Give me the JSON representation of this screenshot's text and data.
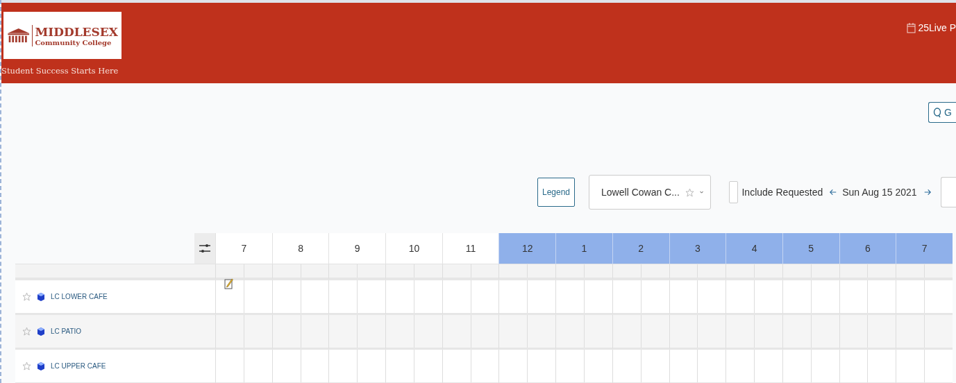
{
  "header": {
    "logo": {
      "name": "MIDDLESEX",
      "subtitle": "Community College"
    },
    "tagline": "Student Success Starts Here",
    "app_link": "25Live P"
  },
  "search_button": {
    "label": "G"
  },
  "toolbar": {
    "legend_button": "Legend",
    "location_dropdown": {
      "value": "Lowell Cowan C...",
      "favorite": false
    },
    "include_requested": {
      "label": "Include Requested",
      "checked": false
    },
    "date": "Sun Aug 15 2021"
  },
  "grid": {
    "hours": [
      {
        "label": "7",
        "shaded": false
      },
      {
        "label": "8",
        "shaded": false
      },
      {
        "label": "9",
        "shaded": false
      },
      {
        "label": "10",
        "shaded": false
      },
      {
        "label": "11",
        "shaded": false
      },
      {
        "label": "12",
        "shaded": true
      },
      {
        "label": "1",
        "shaded": true
      },
      {
        "label": "2",
        "shaded": true
      },
      {
        "label": "3",
        "shaded": true
      },
      {
        "label": "4",
        "shaded": true
      },
      {
        "label": "5",
        "shaded": true
      },
      {
        "label": "6",
        "shaded": true
      },
      {
        "label": "7",
        "shaded": true
      }
    ],
    "rows": [
      {
        "name": "LC LOWER CAFE",
        "favorite": false,
        "note": true
      },
      {
        "name": "LC PATIO",
        "favorite": false,
        "note": false
      },
      {
        "name": "LC UPPER CAFE",
        "favorite": false,
        "note": false
      }
    ]
  }
}
